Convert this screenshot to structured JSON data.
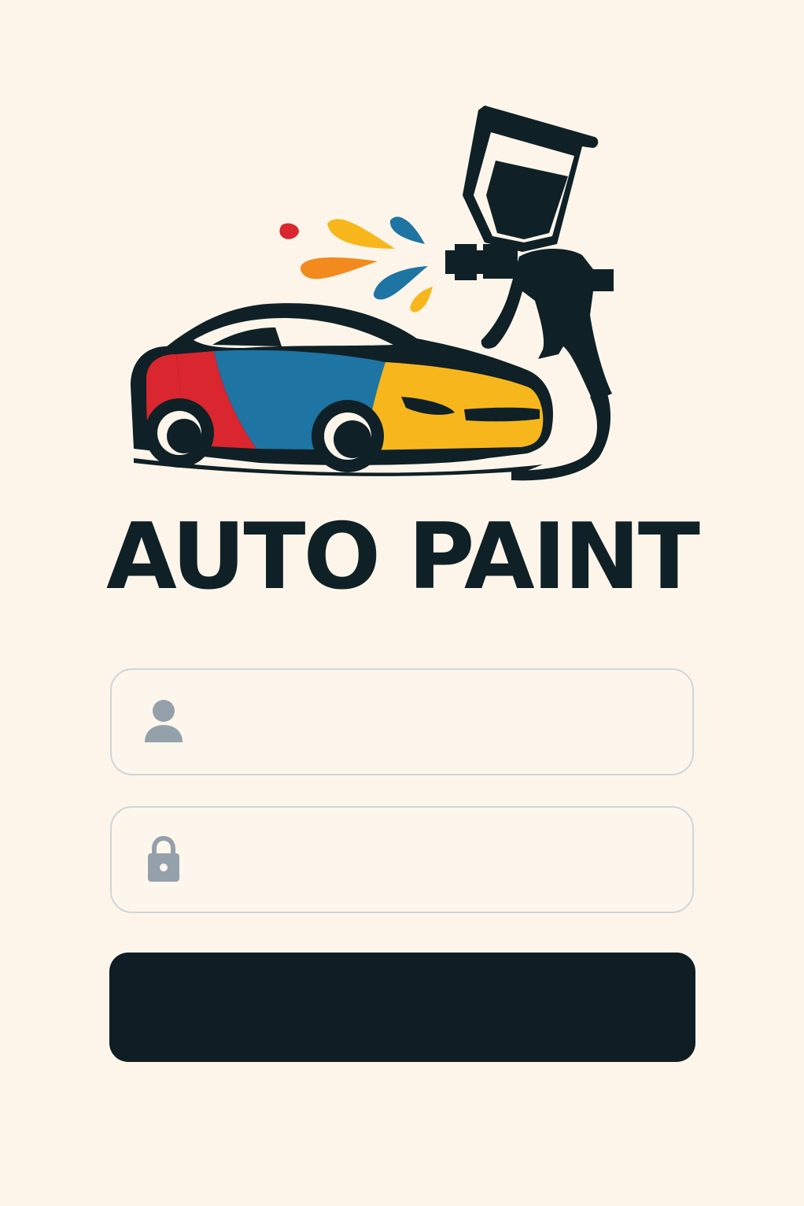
{
  "brand": {
    "title": "AUTO PAINT",
    "logo_icon": "car-spray-gun-logo",
    "colors": {
      "dark": "#0f2026",
      "red": "#d9262f",
      "blue": "#1e74a3",
      "yellow": "#f7b71c",
      "orange": "#f28a1e",
      "background": "#fdf5ea"
    }
  },
  "login": {
    "username": {
      "icon": "user-icon",
      "value": "",
      "placeholder": ""
    },
    "password": {
      "icon": "lock-icon",
      "value": "",
      "placeholder": ""
    },
    "submit": {
      "label": ""
    }
  }
}
